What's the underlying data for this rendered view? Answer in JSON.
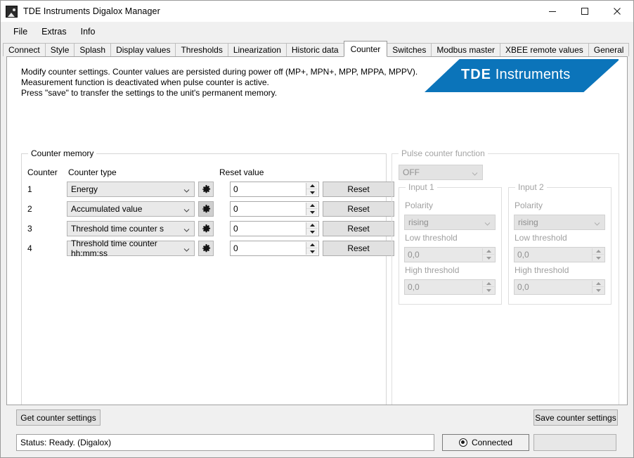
{
  "window": {
    "title": "TDE Instruments Digalox Manager",
    "icon": "gauge-icon",
    "controls": {
      "minimize": "minimize-icon",
      "maximize": "maximize-icon",
      "close": "close-icon"
    }
  },
  "menubar": {
    "items": [
      "File",
      "Extras",
      "Info"
    ]
  },
  "tabs": {
    "items": [
      "Connect",
      "Style",
      "Splash",
      "Display values",
      "Thresholds",
      "Linearization",
      "Historic data",
      "Counter",
      "Switches",
      "Modbus master",
      "XBEE remote values",
      "General"
    ],
    "active": "Counter"
  },
  "description": {
    "line1": "Modify counter settings. Counter values are persisted during power off (MP+, MPN+, MPP, MPPA, MPPV).",
    "line2": "Measurement function is deactivated when pulse counter is active.",
    "line3": "Press \"save\" to transfer the settings to the unit's permanent memory."
  },
  "logo": {
    "bold": "TDE",
    "light": "Instruments",
    "color": "#0b74ba"
  },
  "counter_memory": {
    "legend": "Counter memory",
    "headers": {
      "counter": "Counter",
      "type": "Counter type",
      "reset_value": "Reset value"
    },
    "rows": [
      {
        "num": "1",
        "type": "Energy",
        "reset_value": "0",
        "reset_label": "Reset",
        "gear": "gear-icon"
      },
      {
        "num": "2",
        "type": "Accumulated value",
        "reset_value": "0",
        "reset_label": "Reset",
        "gear": "gear-icon"
      },
      {
        "num": "3",
        "type": "Threshold time counter s",
        "reset_value": "0",
        "reset_label": "Reset",
        "gear": "gear-icon"
      },
      {
        "num": "4",
        "type": "Threshold time counter hh:mm:ss",
        "reset_value": "0",
        "reset_label": "Reset",
        "gear": "gear-icon"
      }
    ]
  },
  "pulse_counter": {
    "legend": "Pulse counter function",
    "mode": "OFF",
    "input1": {
      "legend": "Input 1",
      "polarity_label": "Polarity",
      "polarity_value": "rising",
      "low_label": "Low threshold",
      "low_value": "0,0",
      "high_label": "High threshold",
      "high_value": "0,0"
    },
    "input2": {
      "legend": "Input 2",
      "polarity_label": "Polarity",
      "polarity_value": "rising",
      "low_label": "Low threshold",
      "low_value": "0,0",
      "high_label": "High threshold",
      "high_value": "0,0"
    }
  },
  "actions": {
    "get": "Get counter settings",
    "save": "Save counter settings"
  },
  "statusbar": {
    "status": "Status: Ready. (Digalox)",
    "connection": "Connected",
    "connection_icon": "radio-filled-icon"
  }
}
